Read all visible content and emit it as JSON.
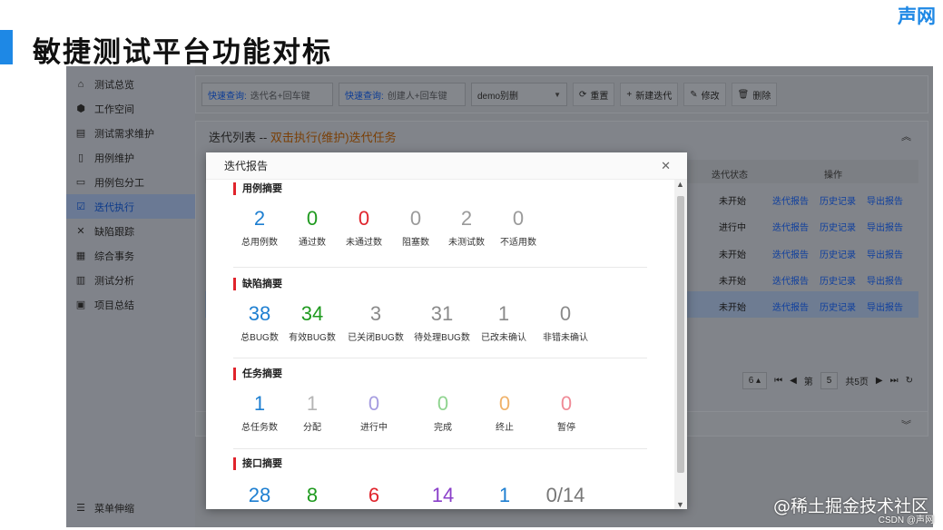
{
  "brand": "声网",
  "slide_title": "敏捷测试平台功能对标",
  "sidebar": {
    "items": [
      {
        "label": "测试总览",
        "icon": "home-icon"
      },
      {
        "label": "工作空间",
        "icon": "cube-icon"
      },
      {
        "label": "测试需求维护",
        "icon": "clipboard-icon"
      },
      {
        "label": "用例维护",
        "icon": "file-icon"
      },
      {
        "label": "用例包分工",
        "icon": "folder-icon"
      },
      {
        "label": "迭代执行",
        "icon": "check-square-icon",
        "active": true
      },
      {
        "label": "缺陷跟踪",
        "icon": "tools-icon"
      },
      {
        "label": "综合事务",
        "icon": "grid-icon"
      },
      {
        "label": "测试分析",
        "icon": "bar-chart-icon"
      },
      {
        "label": "项目总结",
        "icon": "archive-icon"
      }
    ],
    "collapse_label": "菜单伸缩"
  },
  "toolbar": {
    "quick1_key": "快速查询:",
    "quick1_placeholder": "迭代名+回车键",
    "quick2_key": "快速查询:",
    "quick2_placeholder": "创建人+回车键",
    "select_value": "demo别删",
    "reset": "重置",
    "new_iteration": "新建迭代",
    "edit": "修改",
    "delete": "删除"
  },
  "panel": {
    "title": "迭代列表 --",
    "hint": "双击执行(维护)迭代任务",
    "col_status": "迭代状态",
    "col_ops": "操作",
    "rows": [
      {
        "status": "未开始"
      },
      {
        "status": "进行中"
      },
      {
        "status": "未开始"
      },
      {
        "status": "未开始"
      },
      {
        "status": "未开始"
      }
    ],
    "op_report": "迭代报告",
    "op_history": "历史记录",
    "op_export": "导出报告",
    "pager": {
      "size": "6",
      "page_prefix": "第",
      "page": "5",
      "total": "共5页"
    }
  },
  "modal": {
    "title": "迭代报告",
    "sections": [
      {
        "title": "用例摘要",
        "stats": [
          {
            "value": "2",
            "label": "总用例数",
            "color": "#1e7fd1"
          },
          {
            "value": "0",
            "label": "通过数",
            "color": "#1f9a1f"
          },
          {
            "value": "0",
            "label": "未通过数",
            "color": "#e0242c"
          },
          {
            "value": "0",
            "label": "阻塞数",
            "color": "#9a9a9a"
          },
          {
            "value": "2",
            "label": "未测试数",
            "color": "#9a9a9a"
          },
          {
            "value": "0",
            "label": "不适用数",
            "color": "#9a9a9a"
          }
        ]
      },
      {
        "title": "缺陷摘要",
        "stats": [
          {
            "value": "38",
            "label": "总BUG数",
            "color": "#1e7fd1"
          },
          {
            "value": "34",
            "label": "有效BUG数",
            "color": "#1f9a1f"
          },
          {
            "value": "3",
            "label": "已关闭BUG数",
            "color": "#8a8a8a"
          },
          {
            "value": "31",
            "label": "待处理BUG数",
            "color": "#8a8a8a"
          },
          {
            "value": "1",
            "label": "已改未确认",
            "color": "#8a8a8a"
          },
          {
            "value": "0",
            "label": "非错未确认",
            "color": "#8a8a8a"
          }
        ]
      },
      {
        "title": "任务摘要",
        "stats": [
          {
            "value": "1",
            "label": "总任务数",
            "color": "#1e7fd1"
          },
          {
            "value": "1",
            "label": "分配",
            "color": "#b5b5b5"
          },
          {
            "value": "0",
            "label": "进行中",
            "color": "#a59ce0"
          },
          {
            "value": "0",
            "label": "完成",
            "color": "#8fd48f"
          },
          {
            "value": "0",
            "label": "终止",
            "color": "#f0b26a"
          },
          {
            "value": "0",
            "label": "暂停",
            "color": "#f08a96"
          }
        ]
      },
      {
        "title": "接口摘要",
        "stats": [
          {
            "value": "28",
            "label": "",
            "color": "#1e7fd1"
          },
          {
            "value": "8",
            "label": "",
            "color": "#1f9a1f"
          },
          {
            "value": "6",
            "label": "",
            "color": "#e0242c"
          },
          {
            "value": "14",
            "label": "",
            "color": "#8a3fc9"
          },
          {
            "value": "1",
            "label": "",
            "color": "#1e7fd1"
          },
          {
            "value": "0/14",
            "label": "",
            "color": "#777777"
          }
        ]
      }
    ]
  },
  "watermark": "@稀土掘金技术社区",
  "watermark_sub": "CSDN @声网"
}
